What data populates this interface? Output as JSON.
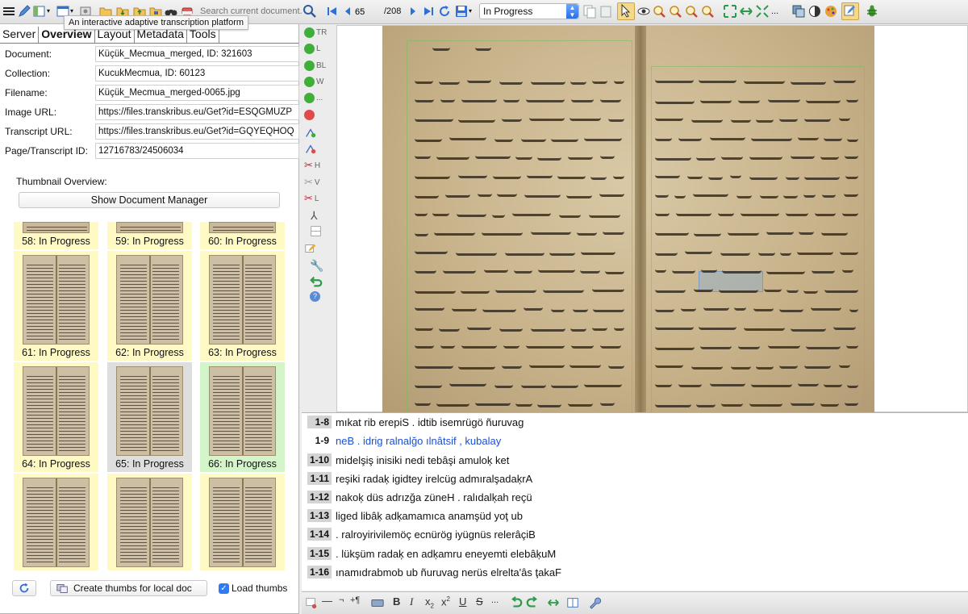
{
  "app": {
    "tooltip": "An interactive adaptive transcription platform"
  },
  "toolbar": {
    "search_placeholder": "Search current document...",
    "page_current": "65",
    "page_total": "/208",
    "status_value": "In Progress"
  },
  "left_panel": {
    "tabs": [
      "Server",
      "Overview",
      "Layout",
      "Metadata",
      "Tools"
    ],
    "active_tab": "Overview",
    "fields": [
      {
        "label": "Document:",
        "value": "Küçük_Mecmua_merged, ID: 321603"
      },
      {
        "label": "Collection:",
        "value": "KucukMecmua, ID: 60123"
      },
      {
        "label": "Filename:",
        "value": "Küçük_Mecmua_merged-0065.jpg"
      },
      {
        "label": "Image URL:",
        "value": "https://files.transkribus.eu/Get?id=ESQGMUZP"
      },
      {
        "label": "Transcript URL:",
        "value": "https://files.transkribus.eu/Get?id=GQYEQHOQ"
      },
      {
        "label": "Page/Transcript ID:",
        "value": "12716783/24506034"
      }
    ],
    "thumbnail_overview_label": "Thumbnail Overview:",
    "show_document_manager": "Show Document Manager",
    "thumbnails": [
      {
        "label": "58: In Progress",
        "state": "progress"
      },
      {
        "label": "59: In Progress",
        "state": "progress"
      },
      {
        "label": "60: In Progress",
        "state": "progress"
      },
      {
        "label": "61: In Progress",
        "state": "progress"
      },
      {
        "label": "62: In Progress",
        "state": "progress"
      },
      {
        "label": "63: In Progress",
        "state": "progress"
      },
      {
        "label": "64: In Progress",
        "state": "progress"
      },
      {
        "label": "65: In Progress",
        "state": "current"
      },
      {
        "label": "66: In Progress",
        "state": "done"
      }
    ],
    "create_thumbs_label": "Create thumbs for local doc",
    "load_thumbs_label": "Load thumbs",
    "load_thumbs_checked": true
  },
  "tool_strip": {
    "items": [
      "TR",
      "L",
      "BL",
      "W",
      "...",
      "",
      "",
      "",
      "H",
      "V",
      "L"
    ]
  },
  "transcription": {
    "lines": [
      {
        "num": "1-8",
        "text": "mıkat rib erepiS . idtib isemrügö ñuruvag"
      },
      {
        "num": "1-9",
        "text": "neB . idrig ralnalğo ılnâtsif , kubalay",
        "active": true
      },
      {
        "num": "1-10",
        "text": "midelşiş inisiki nedi tebâşi amuloķ ket"
      },
      {
        "num": "1-11",
        "text": "reşiki radaķ igidtey irelcüg admıralşadaķrA"
      },
      {
        "num": "1-12",
        "text": "nakoķ düs adrızğa züneH . ralıdalķah reçü"
      },
      {
        "num": "1-13",
        "text": "liged libâķ adķamamıca anamşüd yoţ ub"
      },
      {
        "num": "1-14",
        "text": ". ralroyirivilemöç ecnürög iyügnüs relerâçiB"
      },
      {
        "num": "1-15",
        "text": ". lükşüm radaķ en adķamru eneyemti elebâķuM"
      },
      {
        "num": "1-16",
        "text": "ınamıdrabmob ub ñuruvag nerüs elrelta'âs ţakaF"
      }
    ]
  },
  "colors": {
    "thumb_progress": "#fff9c4",
    "thumb_current": "#dedede",
    "thumb_done": "#d3f5c9",
    "active_line_text": "#1b4fd8"
  }
}
